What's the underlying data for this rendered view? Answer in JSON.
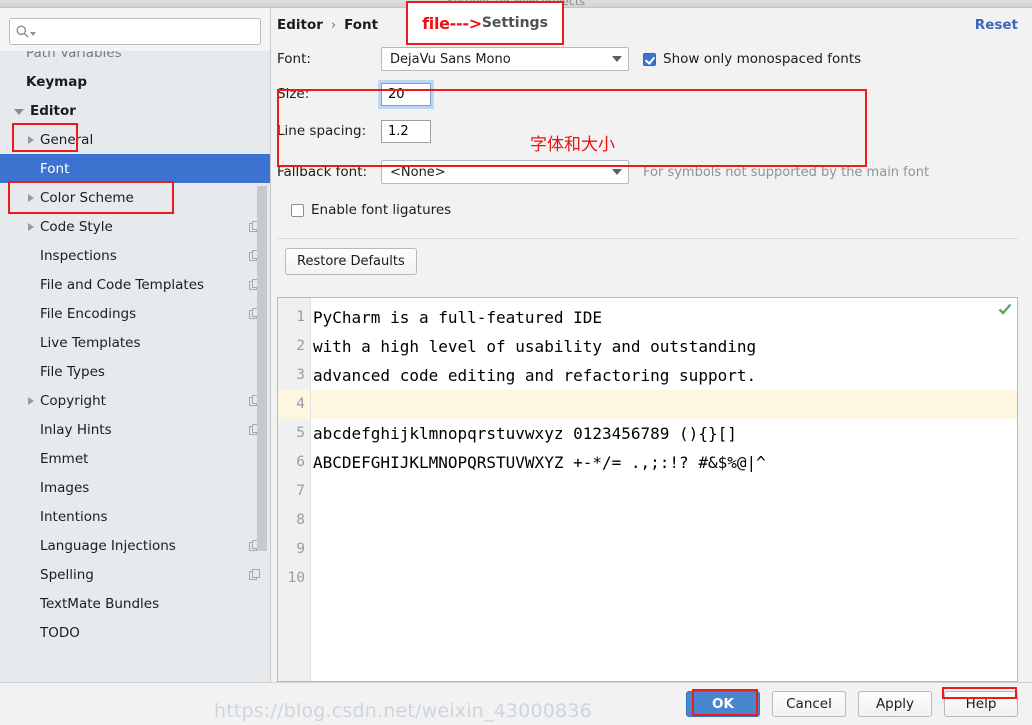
{
  "window": {
    "ghost_title": "Settings for New Projects"
  },
  "annotation": {
    "callout_red": "file--->",
    "callout_gray": "Settings",
    "chinese_note": "字体和大小"
  },
  "sidebar": {
    "search": {
      "value": "",
      "placeholder": "",
      "icon": "search-icon"
    },
    "items": [
      {
        "label": "Path Variables",
        "level": 0,
        "arrow": "none",
        "bold": false,
        "selected": false,
        "copy": false,
        "clipped": true
      },
      {
        "label": "Keymap",
        "level": 0,
        "arrow": "none",
        "bold": true,
        "selected": false,
        "copy": false,
        "clipped": false
      },
      {
        "label": "Editor",
        "level": 0,
        "arrow": "down",
        "bold": true,
        "selected": false,
        "copy": false,
        "clipped": false
      },
      {
        "label": "General",
        "level": 1,
        "arrow": "right",
        "bold": false,
        "selected": false,
        "copy": false,
        "clipped": false
      },
      {
        "label": "Font",
        "level": 1,
        "arrow": "none",
        "bold": false,
        "selected": true,
        "copy": false,
        "clipped": false
      },
      {
        "label": "Color Scheme",
        "level": 1,
        "arrow": "right",
        "bold": false,
        "selected": false,
        "copy": false,
        "clipped": false
      },
      {
        "label": "Code Style",
        "level": 1,
        "arrow": "right",
        "bold": false,
        "selected": false,
        "copy": true,
        "clipped": false
      },
      {
        "label": "Inspections",
        "level": 1,
        "arrow": "none",
        "bold": false,
        "selected": false,
        "copy": true,
        "clipped": false
      },
      {
        "label": "File and Code Templates",
        "level": 1,
        "arrow": "none",
        "bold": false,
        "selected": false,
        "copy": true,
        "clipped": false
      },
      {
        "label": "File Encodings",
        "level": 1,
        "arrow": "none",
        "bold": false,
        "selected": false,
        "copy": true,
        "clipped": false
      },
      {
        "label": "Live Templates",
        "level": 1,
        "arrow": "none",
        "bold": false,
        "selected": false,
        "copy": false,
        "clipped": false
      },
      {
        "label": "File Types",
        "level": 1,
        "arrow": "none",
        "bold": false,
        "selected": false,
        "copy": false,
        "clipped": false
      },
      {
        "label": "Copyright",
        "level": 1,
        "arrow": "right",
        "bold": false,
        "selected": false,
        "copy": true,
        "clipped": false
      },
      {
        "label": "Inlay Hints",
        "level": 1,
        "arrow": "none",
        "bold": false,
        "selected": false,
        "copy": true,
        "clipped": false
      },
      {
        "label": "Emmet",
        "level": 1,
        "arrow": "none",
        "bold": false,
        "selected": false,
        "copy": false,
        "clipped": false
      },
      {
        "label": "Images",
        "level": 1,
        "arrow": "none",
        "bold": false,
        "selected": false,
        "copy": false,
        "clipped": false
      },
      {
        "label": "Intentions",
        "level": 1,
        "arrow": "none",
        "bold": false,
        "selected": false,
        "copy": false,
        "clipped": false
      },
      {
        "label": "Language Injections",
        "level": 1,
        "arrow": "none",
        "bold": false,
        "selected": false,
        "copy": true,
        "clipped": false
      },
      {
        "label": "Spelling",
        "level": 1,
        "arrow": "none",
        "bold": false,
        "selected": false,
        "copy": true,
        "clipped": false
      },
      {
        "label": "TextMate Bundles",
        "level": 1,
        "arrow": "none",
        "bold": false,
        "selected": false,
        "copy": false,
        "clipped": false
      },
      {
        "label": "TODO",
        "level": 1,
        "arrow": "none",
        "bold": false,
        "selected": false,
        "copy": false,
        "clipped": false
      }
    ]
  },
  "breadcrumb": {
    "parent": "Editor",
    "separator": "›",
    "current": "Font",
    "reset_label": "Reset"
  },
  "form": {
    "font_label": "Font:",
    "font_value": "DejaVu Sans Mono",
    "monospaced_label": "Show only monospaced fonts",
    "monospaced_checked": true,
    "size_label": "Size:",
    "size_value": "20",
    "line_spacing_label": "Line spacing:",
    "line_spacing_value": "1.2",
    "fallback_label": "Fallback font:",
    "fallback_value": "<None>",
    "fallback_hint": "For symbols not supported by the main font",
    "ligatures_label": "Enable font ligatures",
    "ligatures_checked": false,
    "restore_defaults_label": "Restore Defaults"
  },
  "preview": {
    "lines": [
      {
        "num": "1",
        "text": "PyCharm is a full-featured IDE",
        "highlight": false
      },
      {
        "num": "2",
        "text": "with a high level of usability and outstanding",
        "highlight": false
      },
      {
        "num": "3",
        "text": "advanced code editing and refactoring support.",
        "highlight": false
      },
      {
        "num": "4",
        "text": "",
        "highlight": true
      },
      {
        "num": "5",
        "text": "abcdefghijklmnopqrstuvwxyz 0123456789 (){}[]",
        "highlight": false
      },
      {
        "num": "6",
        "text": "ABCDEFGHIJKLMNOPQRSTUVWXYZ +-*/= .,;:!? #&$%@|^",
        "highlight": false
      },
      {
        "num": "7",
        "text": "",
        "highlight": false
      },
      {
        "num": "8",
        "text": "",
        "highlight": false
      },
      {
        "num": "9",
        "text": "",
        "highlight": false
      },
      {
        "num": "10",
        "text": "",
        "highlight": false
      }
    ],
    "inspection_icon": "green-check-icon"
  },
  "footer": {
    "ok": "OK",
    "cancel": "Cancel",
    "apply": "Apply",
    "help": "Help",
    "watermark": "https://blog.csdn.net/weixin_43000836"
  },
  "colors": {
    "accent": "#3c73d0",
    "annotation_red": "#ec1c1c",
    "link": "#3a67bd",
    "sidebar_bg": "#e6eaed",
    "highlight_line": "#fdf7e2"
  }
}
